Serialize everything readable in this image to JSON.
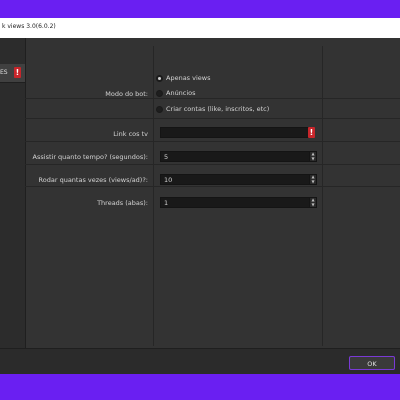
{
  "window": {
    "title": "k views 3.0(6.0.2)"
  },
  "sidebar": {
    "tab_label": "ES",
    "tab_alert": "!"
  },
  "form": {
    "bot_mode_label": "Modo do bot:",
    "bot_mode_options": [
      {
        "label": "Apenas views",
        "selected": true
      },
      {
        "label": "Anúncios",
        "selected": false
      },
      {
        "label": "Criar contas (like, inscritos, etc)",
        "selected": false
      }
    ],
    "link_label": "Link cos tv",
    "link_value": "",
    "link_alert": "!",
    "watch_time_label": "Assistir quanto tempo? (segundos):",
    "watch_time_value": "5",
    "runs_label": "Rodar quantas vezes (views/ad)?:",
    "runs_value": "10",
    "threads_label": "Threads (abas):",
    "threads_value": "1"
  },
  "footer": {
    "ok_label": "OK"
  },
  "colors": {
    "frame": "#6a1ff2",
    "window_bg": "#333333",
    "field_bg": "#191919",
    "alert": "#c8262b",
    "ok_border": "#7a3ad6"
  }
}
